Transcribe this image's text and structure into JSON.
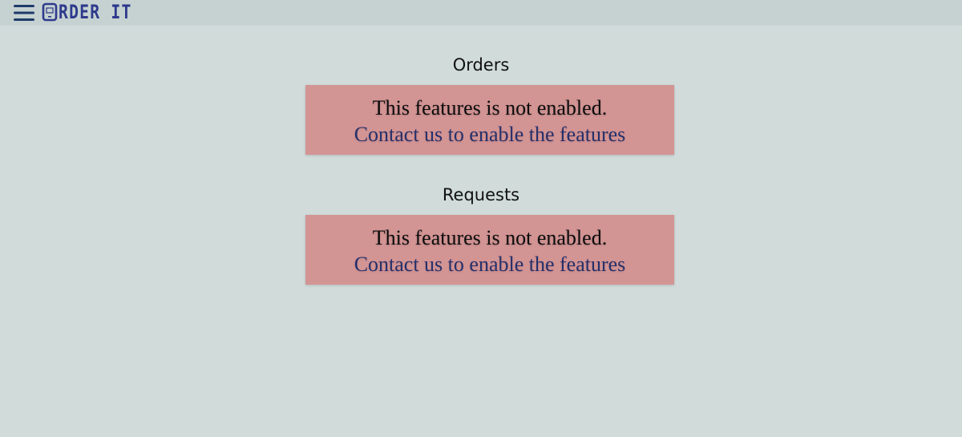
{
  "header": {
    "menu_icon": "hamburger-menu-icon",
    "logo_text": "RDER IT",
    "logo_mark": "tablet-o-icon",
    "colors": {
      "bar": "#c6d2d1",
      "logo": "#2e3a8c",
      "menu_icon": "#1f3a6a"
    }
  },
  "sections": [
    {
      "title": "Orders",
      "message": "This features is not enabled.",
      "link": "Contact us to enable the features"
    },
    {
      "title": "Requests",
      "message": "This features is not enabled.",
      "link": "Contact us to enable the features"
    }
  ],
  "colors": {
    "background": "#d0dbda",
    "notice_bg": "#d39494",
    "link": "#26306a"
  }
}
